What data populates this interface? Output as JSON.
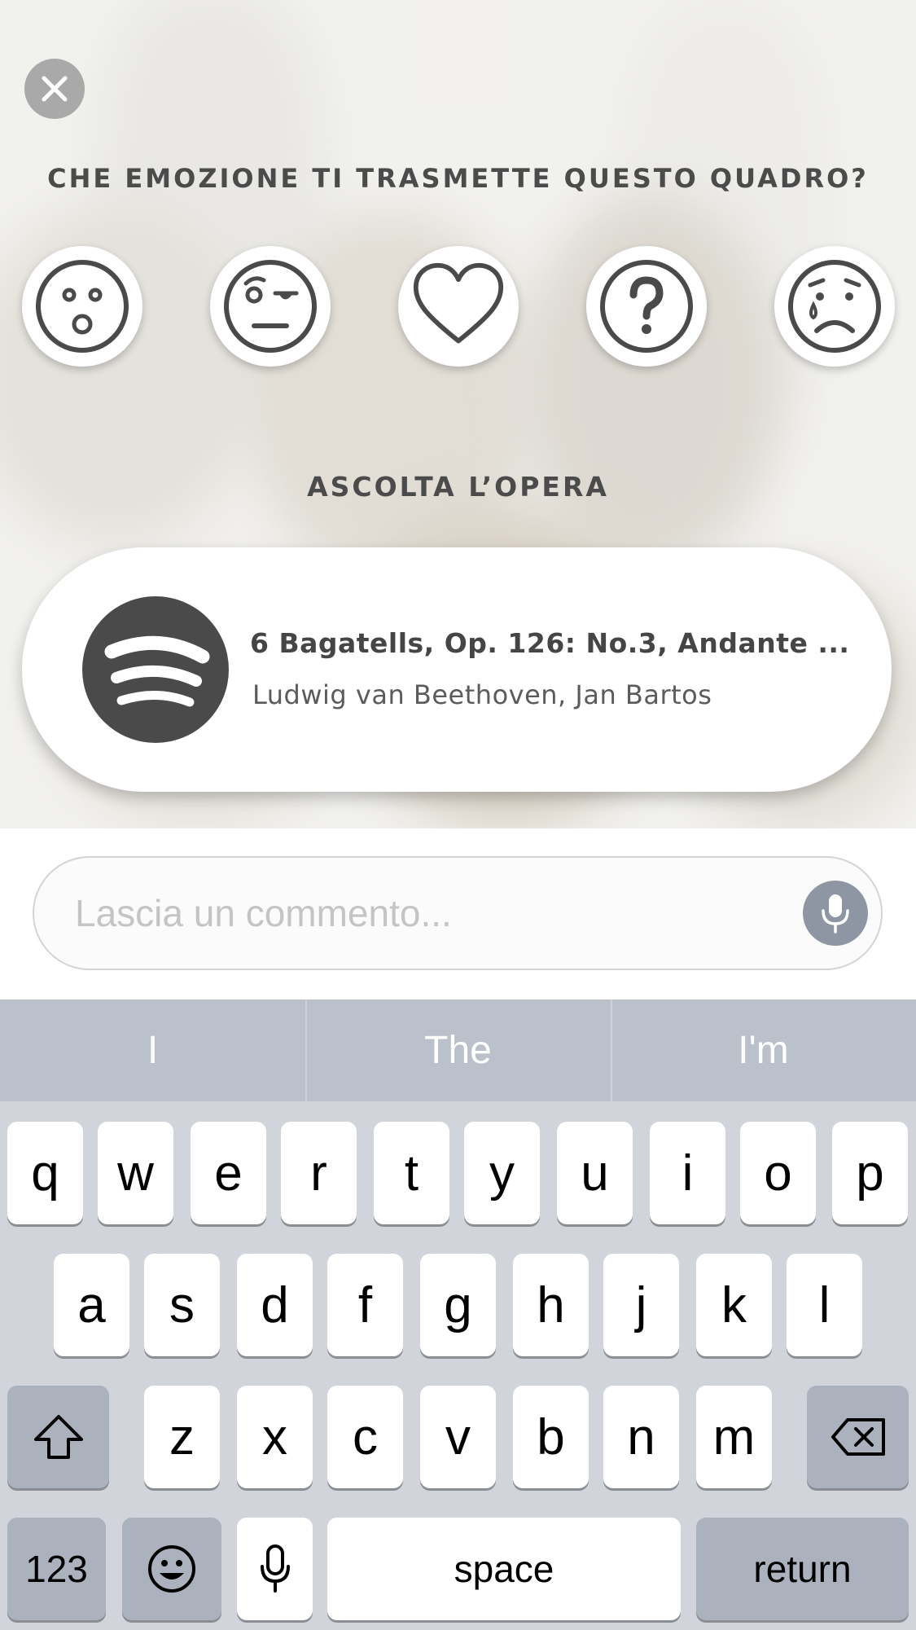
{
  "header": {
    "close_icon": "close-icon",
    "question": "CHE EMOZIONE TI TRASMETTE QUESTO QUADRO?"
  },
  "emotions": [
    {
      "id": "surprised",
      "icon": "surprised-face-icon"
    },
    {
      "id": "skeptical",
      "icon": "skeptical-face-icon"
    },
    {
      "id": "love",
      "icon": "heart-icon"
    },
    {
      "id": "confused",
      "icon": "question-mark-icon"
    },
    {
      "id": "sad",
      "icon": "crying-face-icon"
    }
  ],
  "listen": {
    "title": "ASCOLTA L’OPERA",
    "track": {
      "title": "6 Bagatells, Op. 126: No.3, Andante ...",
      "artist": "Ludwig van Beethoven, Jan Bartos",
      "icon": "spotify-icon"
    }
  },
  "comment": {
    "placeholder": "Lascia un commento...",
    "value": "",
    "mic_icon": "microphone-icon"
  },
  "keyboard": {
    "suggestions": [
      "I",
      "The",
      "I'm"
    ],
    "row1": [
      "q",
      "w",
      "e",
      "r",
      "t",
      "y",
      "u",
      "i",
      "o",
      "p"
    ],
    "row2": [
      "a",
      "s",
      "d",
      "f",
      "g",
      "h",
      "j",
      "k",
      "l"
    ],
    "row3": [
      "z",
      "x",
      "c",
      "v",
      "b",
      "n",
      "m"
    ],
    "numbers_label": "123",
    "space_label": "space",
    "return_label": "return"
  },
  "colors": {
    "icon_gray": "#4a4a4a",
    "keyboard_bg": "#d1d4da",
    "suggestion_bar": "#bbc1ca",
    "mic_button": "#8e96a4"
  }
}
